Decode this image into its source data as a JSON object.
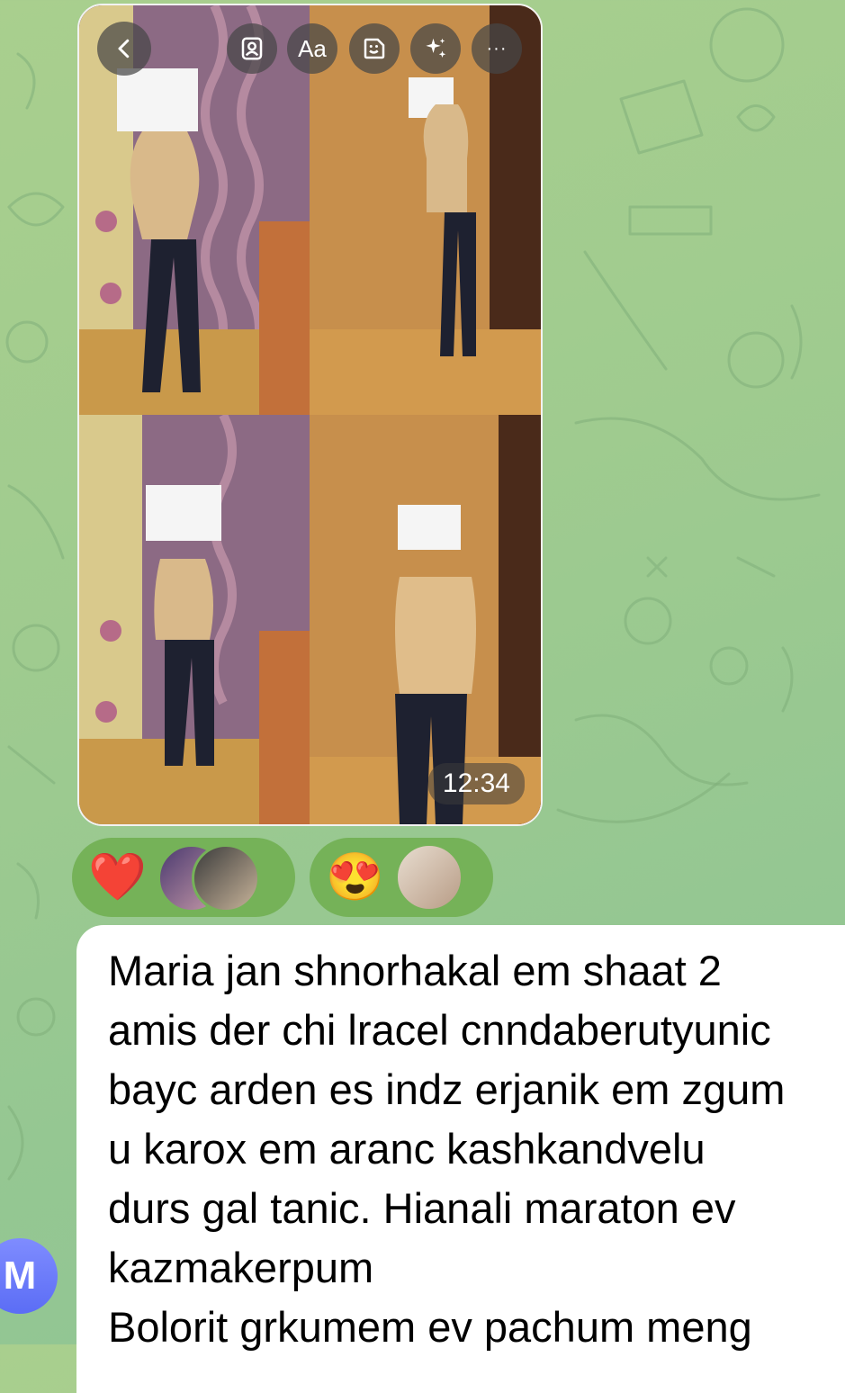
{
  "toolbar": {
    "back_icon": "chevron-left-icon",
    "tools": [
      {
        "icon": "portrait-icon",
        "label": ""
      },
      {
        "icon": "text-tool-icon",
        "label": "Aa"
      },
      {
        "icon": "sticker-icon",
        "label": ""
      },
      {
        "icon": "sparkles-icon",
        "label": ""
      },
      {
        "icon": "more-icon",
        "label": "···"
      }
    ]
  },
  "media": {
    "time": "12:34"
  },
  "reactions": [
    {
      "emoji": "❤️",
      "icon": "heart-emoji"
    },
    {
      "emoji": "😍",
      "icon": "heart-eyes-emoji"
    }
  ],
  "message": {
    "text": "Maria jan shnorhakal em shaat 2\namis der chi lracel cnndaberutyunic\nbayc arden es indz erjanik em zgum\nu karox em aranc kashkandvelu\ndurs gal tanic. Hianali maraton ev\nkazmakerpum\nBolorit grkumem ev pachum meng"
  },
  "sender": {
    "initial": "M"
  },
  "colors": {
    "wallpaper": "#9fcb8f",
    "reaction_bg": "#75b258",
    "bubble_bg": "#ffffff",
    "avatar": "#6a79f7"
  }
}
